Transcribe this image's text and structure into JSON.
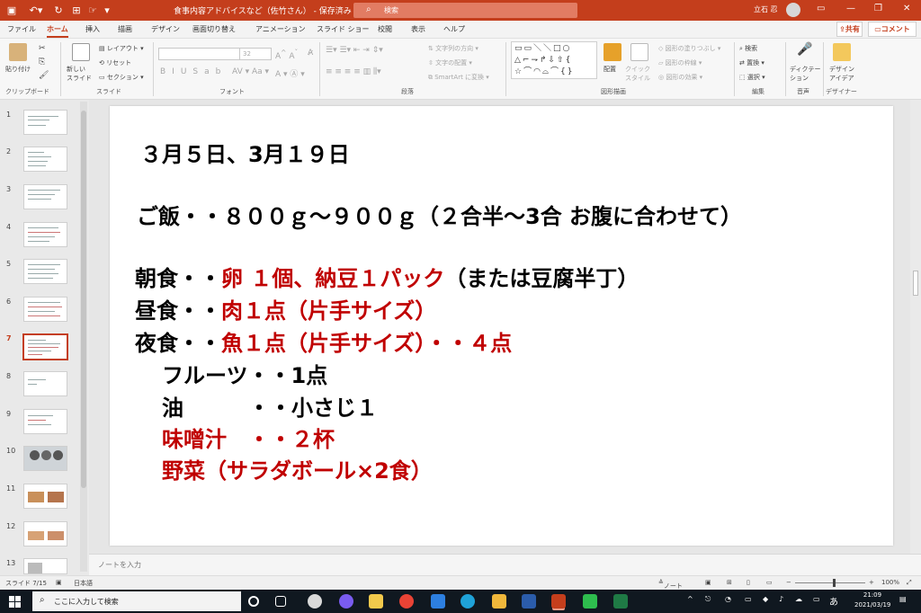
{
  "titlebar": {
    "autosave_icon": "save-icon",
    "undo_icon": "undo-icon",
    "doc_title": "食事内容アドバイスなど（佐竹さん） - 保存済み",
    "search_placeholder": "検索",
    "user_name": "立石 忍",
    "accent": "#c43e1c"
  },
  "tabs": [
    "ファイル",
    "ホーム",
    "挿入",
    "描画",
    "デザイン",
    "画面切り替え",
    "アニメーション",
    "スライド ショー",
    "校閲",
    "表示",
    "ヘルプ"
  ],
  "share_label": "共有",
  "comment_label": "コメント",
  "ribbon": {
    "paste": "貼り付け",
    "new_slide": "新しい\nスライド",
    "layout": "レイアウト",
    "reset": "リセット",
    "section": "セクション",
    "font_size": "32",
    "text_direction": "文字列の方向",
    "align_text": "文字の配置",
    "smartart": "SmartArt に変換",
    "arrange": "配置",
    "quick_style": "クイック\nスタイル",
    "shape_fill": "図形の塗りつぶし",
    "shape_outline": "図形の枠線",
    "shape_effects": "図形の効果",
    "find": "検索",
    "replace": "置換",
    "select": "選択",
    "dictate": "ディクテー\nション",
    "design_ideas": "デザイン\nアイデア",
    "groups": [
      "クリップボード",
      "スライド",
      "フォント",
      "段落",
      "図形描画",
      "編集",
      "音声",
      "デザイナー"
    ]
  },
  "thumbnails": [
    "1",
    "2",
    "3",
    "4",
    "5",
    "6",
    "7",
    "8",
    "9",
    "10",
    "11",
    "12",
    "13"
  ],
  "selected_slide": 7,
  "slide": {
    "date": "３月５日、3月１９日",
    "rice": "ご飯・・８００ｇ～９００ｇ（２合半～3合 お腹に合わせて）",
    "breakfast_label": "朝食・・",
    "breakfast_red": "卵 １個、納豆１パック",
    "breakfast_rest": "（または豆腐半丁）",
    "lunch_label": "昼食・・",
    "lunch_red": "肉１点（片手サイズ）",
    "dinner_label": "夜食・・",
    "dinner_red": "魚１点（片手サイズ）・・４点",
    "fruit": "フルーツ・・1点",
    "oil": "油　　　・・小さじ１",
    "miso": "味噌汁　・・２杯",
    "veg": "野菜（サラダボール×2食）"
  },
  "notes_placeholder": "ノートを入力",
  "status": {
    "slide_pos": "スライド 7/15",
    "language": "日本語",
    "notes_btn": "ノート",
    "zoom": "100%"
  },
  "taskbar": {
    "search_placeholder": "ここに入力して検索",
    "time": "21:09",
    "date": "2021/03/19",
    "ime": "あ"
  }
}
